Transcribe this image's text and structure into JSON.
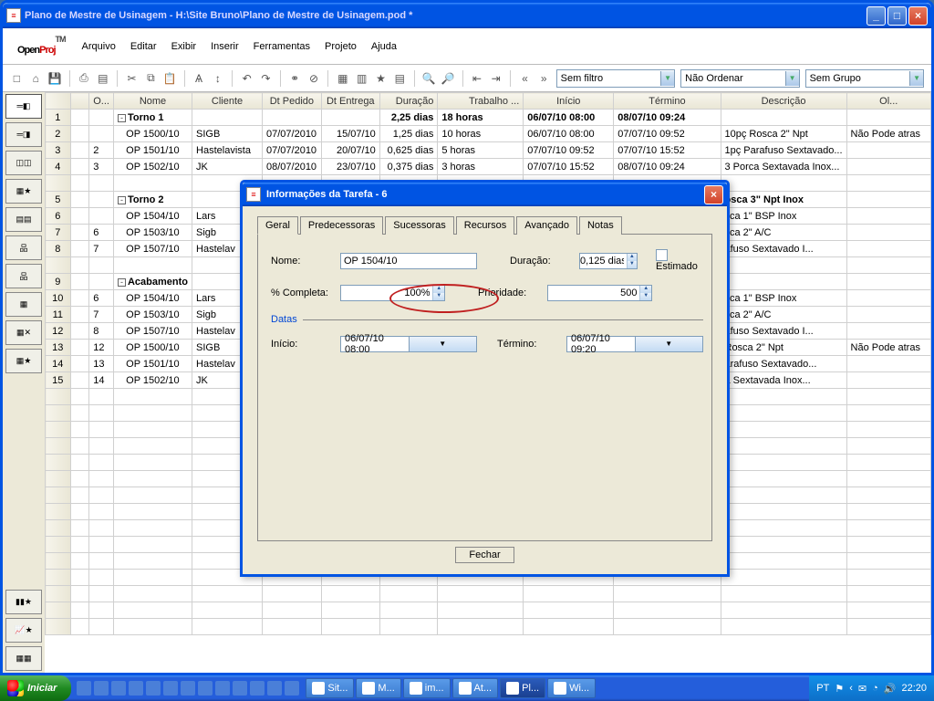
{
  "window": {
    "title": "Plano de Mestre de Usinagem - H:\\Site Bruno\\Plano de Mestre de Usinagem.pod *",
    "logo": {
      "open": "Open",
      "proj": "Proj",
      "tm": "TM"
    }
  },
  "menubar": [
    "Arquivo",
    "Editar",
    "Exibir",
    "Inserir",
    "Ferramentas",
    "Projeto",
    "Ajuda"
  ],
  "toolbar": {
    "filter": "Sem filtro",
    "sort": "Não Ordenar",
    "group": "Sem Grupo"
  },
  "columns": [
    "",
    "O...",
    "Nome",
    "Cliente",
    "Dt Pedido",
    "Dt Entrega",
    "Duração",
    "Trabalho ...",
    "Início",
    "Término",
    "Descrição",
    "Ol..."
  ],
  "rows": [
    {
      "n": "1",
      "ord": "",
      "nome": "Torno 1",
      "outline": "-",
      "bold": true,
      "cli": "",
      "dtp": "",
      "dte": "",
      "dur": "2,25 dias",
      "trab": "18 horas",
      "ini": "06/07/10 08:00",
      "ter": "08/07/10 09:24",
      "desc": "",
      "ol": ""
    },
    {
      "n": "2",
      "ord": "",
      "nome": "OP 1500/10",
      "indent": 1,
      "cli": "SIGB",
      "dtp": "07/07/2010",
      "dte": "15/07/10",
      "dur": "1,25 dias",
      "trab": "10 horas",
      "ini": "06/07/10 08:00",
      "ter": "07/07/10 09:52",
      "desc": "10pç Rosca 2\" Npt",
      "ol": "Não Pode atras"
    },
    {
      "n": "3",
      "ord": "2",
      "nome": "OP 1501/10",
      "indent": 1,
      "cli": "Hastelavista",
      "dtp": "07/07/2010",
      "dte": "20/07/10",
      "dur": "0,625 dias",
      "trab": "5 horas",
      "ini": "07/07/10 09:52",
      "ter": "07/07/10 15:52",
      "desc": "1pç Parafuso Sextavado...",
      "ol": ""
    },
    {
      "n": "4",
      "ord": "3",
      "nome": "OP 1502/10",
      "indent": 1,
      "cli": "JK",
      "dtp": "08/07/2010",
      "dte": "23/07/10",
      "dur": "0,375 dias",
      "trab": "3 horas",
      "ini": "07/07/10 15:52",
      "ter": "08/07/10 09:24",
      "desc": "3 Porca Sextavada Inox...",
      "ol": ""
    },
    {
      "n": "",
      "blank": true
    },
    {
      "n": "5",
      "ord": "",
      "nome": "Torno 2",
      "outline": "-",
      "bold": true,
      "cli": "",
      "dtp": "",
      "dte": "",
      "dur": "",
      "trab": "",
      "ini": "",
      "ter": "",
      "desc": "osca 3\" Npt Inox",
      "ol": ""
    },
    {
      "n": "6",
      "ord": "",
      "nome": "OP 1504/10",
      "indent": 1,
      "cli": "Lars",
      "dtp": "",
      "dte": "",
      "dur": "",
      "trab": "",
      "ini": "",
      "ter": "",
      "desc": "sca 1\" BSP Inox",
      "ol": ""
    },
    {
      "n": "7",
      "ord": "6",
      "nome": "OP 1503/10",
      "indent": 1,
      "cli": "Sigb",
      "dtp": "",
      "dte": "",
      "dur": "",
      "trab": "",
      "ini": "",
      "ter": "",
      "desc": "sca 2\" A/C",
      "ol": ""
    },
    {
      "n": "8",
      "ord": "7",
      "nome": "OP 1507/10",
      "indent": 1,
      "cli": "Hastelav",
      "dtp": "",
      "dte": "",
      "dur": "",
      "trab": "",
      "ini": "",
      "ter": "",
      "desc": "afuso Sextavado I...",
      "ol": ""
    },
    {
      "n": "",
      "blank": true
    },
    {
      "n": "9",
      "ord": "",
      "nome": "Acabamento",
      "outline": "-",
      "bold": true,
      "cli": "",
      "dtp": "",
      "dte": "",
      "dur": "",
      "trab": "",
      "ini": "",
      "ter": "",
      "desc": "",
      "ol": ""
    },
    {
      "n": "10",
      "ord": "6",
      "nome": "OP 1504/10",
      "indent": 1,
      "cli": "Lars",
      "dtp": "",
      "dte": "",
      "dur": "",
      "trab": "",
      "ini": "",
      "ter": "",
      "desc": "sca 1\" BSP Inox",
      "ol": ""
    },
    {
      "n": "11",
      "ord": "7",
      "nome": "OP 1503/10",
      "indent": 1,
      "cli": "Sigb",
      "dtp": "",
      "dte": "",
      "dur": "",
      "trab": "",
      "ini": "",
      "ter": "",
      "desc": "sca 2\" A/C",
      "ol": ""
    },
    {
      "n": "12",
      "ord": "8",
      "nome": "OP 1507/10",
      "indent": 1,
      "cli": "Hastelav",
      "dtp": "",
      "dte": "",
      "dur": "",
      "trab": "",
      "ini": "",
      "ter": "",
      "desc": "afuso Sextavado I...",
      "ol": ""
    },
    {
      "n": "13",
      "ord": "12",
      "nome": "OP 1500/10",
      "indent": 1,
      "cli": "SIGB",
      "dtp": "",
      "dte": "",
      "dur": "",
      "trab": "",
      "ini": "",
      "ter": "",
      "desc": "Rosca 2\" Npt",
      "ol": "Não Pode atras"
    },
    {
      "n": "14",
      "ord": "13",
      "nome": "OP 1501/10",
      "indent": 1,
      "cli": "Hastelav",
      "dtp": "",
      "dte": "",
      "dur": "",
      "trab": "",
      "ini": "",
      "ter": "",
      "desc": "arafuso Sextavado...",
      "ol": ""
    },
    {
      "n": "15",
      "ord": "14",
      "nome": "OP 1502/10",
      "indent": 1,
      "cli": "JK",
      "dtp": "",
      "dte": "",
      "dur": "",
      "trab": "",
      "ini": "",
      "ter": "",
      "desc": "a Sextavada Inox...",
      "ol": ""
    }
  ],
  "dialog": {
    "title": "Informações da Tarefa - 6",
    "tabs": [
      "Geral",
      "Predecessoras",
      "Sucessoras",
      "Recursos",
      "Avançado",
      "Notas"
    ],
    "activeTab": 0,
    "labels": {
      "nome": "Nome:",
      "duracao": "Duração:",
      "estimado": "Estimado",
      "pctcompleta": "% Completa:",
      "prioridade": "Prioridade:",
      "datas": "Datas",
      "inicio": "Início:",
      "termino": "Término:"
    },
    "values": {
      "nome": "OP 1504/10",
      "duracao": "0,125 dias",
      "pctcompleta": "100%",
      "prioridade": "500",
      "inicio": "06/07/10 08:00",
      "termino": "06/07/10 09:20"
    },
    "close": "Fechar"
  },
  "taskbar": {
    "start": "Iniciar",
    "tasks": [
      {
        "label": "Sit..."
      },
      {
        "label": "M..."
      },
      {
        "label": "im..."
      },
      {
        "label": "At..."
      },
      {
        "label": "Pl...",
        "active": true
      },
      {
        "label": "Wi..."
      }
    ],
    "lang": "PT",
    "clock": "22:20"
  }
}
